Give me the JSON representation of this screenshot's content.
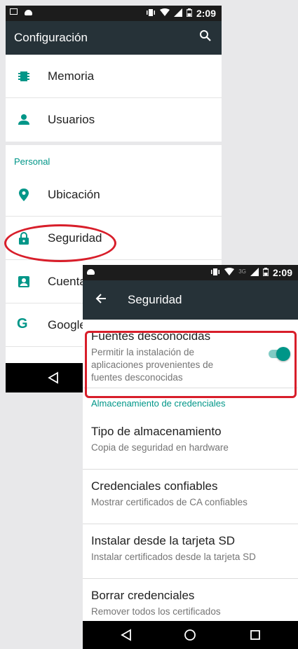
{
  "screen1": {
    "status": {
      "time": "2:09"
    },
    "appbar": {
      "title": "Configuración"
    },
    "rows_top": [
      {
        "label": "Memoria",
        "icon": "memory-icon"
      },
      {
        "label": "Usuarios",
        "icon": "person-icon"
      }
    ],
    "section_personal": "Personal",
    "rows_personal": [
      {
        "label": "Ubicación",
        "icon": "location-icon"
      },
      {
        "label": "Seguridad",
        "icon": "lock-icon"
      },
      {
        "label": "Cuentas",
        "icon": "account-box-icon"
      },
      {
        "label": "Google",
        "icon": "google-icon"
      }
    ]
  },
  "screen2": {
    "status": {
      "time": "2:09",
      "network": "3G"
    },
    "appbar": {
      "title": "Seguridad"
    },
    "fuentes": {
      "title": "Fuentes desconocidas",
      "summary": "Permitir la instalación de aplicaciones provenientes de fuentes desconocidas",
      "enabled": true
    },
    "section_credenciales": "Almacenamiento de credenciales",
    "items": [
      {
        "title": "Tipo de almacenamiento",
        "summary": "Copia de seguridad en hardware"
      },
      {
        "title": "Credenciales confiables",
        "summary": "Mostrar certificados de CA confiables"
      },
      {
        "title": "Instalar desde la tarjeta SD",
        "summary": "Instalar certificados desde la tarjeta SD"
      },
      {
        "title": "Borrar credenciales",
        "summary": "Remover todos los certificados"
      }
    ]
  },
  "colors": {
    "accent": "#009688",
    "appbar": "#263238",
    "highlight": "#d81e2a"
  }
}
